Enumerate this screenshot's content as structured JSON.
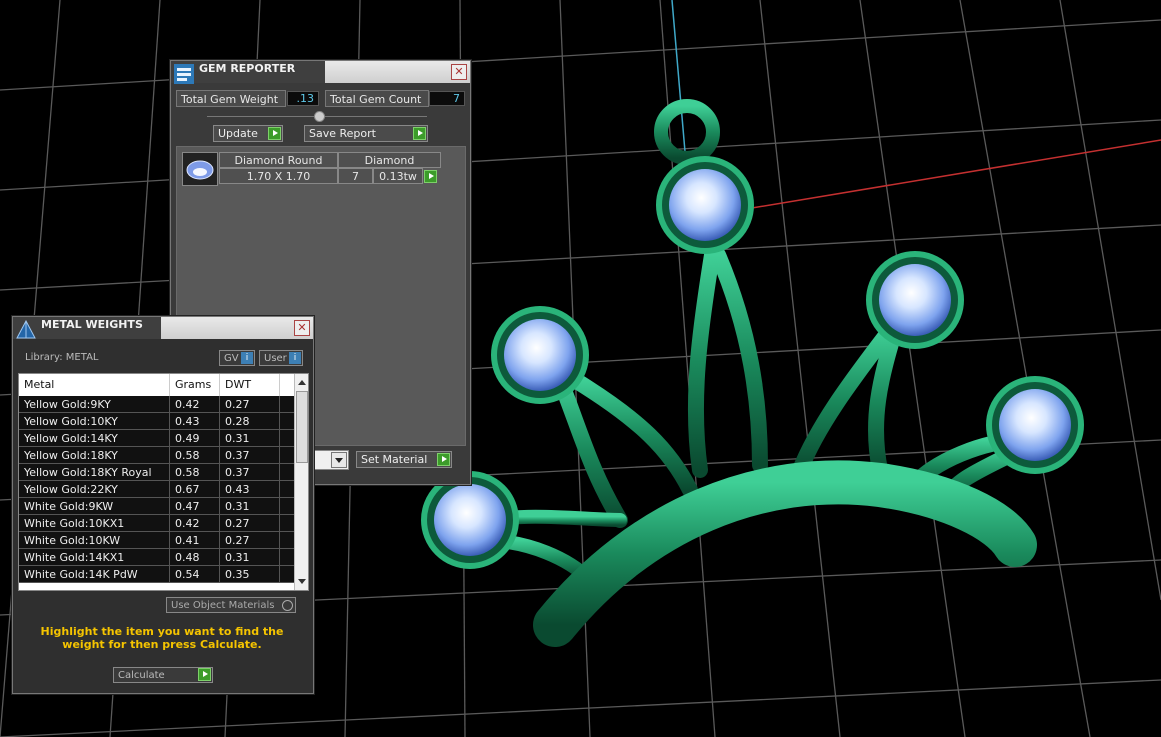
{
  "gem_reporter": {
    "title": "GEM REPORTER",
    "close_glyph": "✕",
    "total_weight_label": "Total Gem Weight",
    "total_weight_value": ".13",
    "total_count_label": "Total Gem Count",
    "total_count_value": "7",
    "update_label": "Update",
    "save_report_label": "Save Report",
    "gem": {
      "shape": "Diamond Round",
      "material": "Diamond",
      "size": "1.70 X 1.70",
      "count": "7",
      "weight": "0.13tw"
    },
    "set_material_label": "Set Material"
  },
  "metal_weights": {
    "title": "METAL WEIGHTS",
    "close_glyph": "✕",
    "library_label": "Library: METAL",
    "gv_label": "GV",
    "user_label": "User",
    "columns": [
      "Metal",
      "Grams",
      "DWT"
    ],
    "rows": [
      {
        "metal": "Yellow Gold:9KY",
        "grams": "0.42",
        "dwt": "0.27"
      },
      {
        "metal": "Yellow Gold:10KY",
        "grams": "0.43",
        "dwt": "0.28"
      },
      {
        "metal": "Yellow Gold:14KY",
        "grams": "0.49",
        "dwt": "0.31"
      },
      {
        "metal": "Yellow Gold:18KY",
        "grams": "0.58",
        "dwt": "0.37"
      },
      {
        "metal": "Yellow Gold:18KY Royal",
        "grams": "0.58",
        "dwt": "0.37"
      },
      {
        "metal": "Yellow Gold:22KY",
        "grams": "0.67",
        "dwt": "0.43"
      },
      {
        "metal": "White Gold:9KW",
        "grams": "0.47",
        "dwt": "0.31"
      },
      {
        "metal": "White Gold:10KX1",
        "grams": "0.42",
        "dwt": "0.27"
      },
      {
        "metal": "White Gold:10KW",
        "grams": "0.41",
        "dwt": "0.27"
      },
      {
        "metal": "White Gold:14KX1",
        "grams": "0.48",
        "dwt": "0.31"
      },
      {
        "metal": "White Gold:14K PdW",
        "grams": "0.54",
        "dwt": "0.35"
      }
    ],
    "use_object_materials_label": "Use Object Materials",
    "hint": "Highlight the item you want to find the weight for then press Calculate.",
    "calculate_label": "Calculate"
  },
  "colors": {
    "jewel_green": "#1f8a5c",
    "gem_blue": "#8fb3f0",
    "hint_yellow": "#f5c400",
    "accent_green": "#3c9c2a"
  }
}
